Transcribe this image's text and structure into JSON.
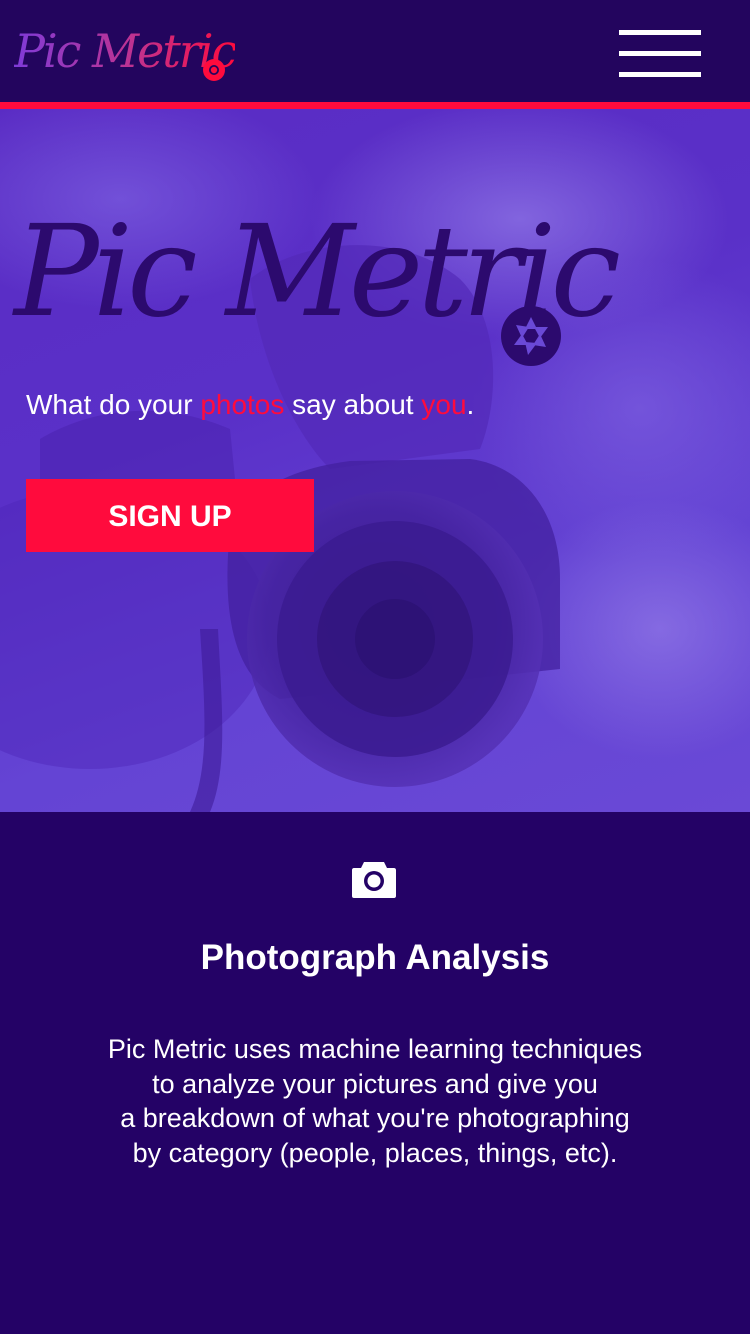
{
  "colors": {
    "header_bg": "#23055e",
    "accent": "#ff0b3d",
    "hero_bg": "#5a30c8",
    "section_bg": "#240266",
    "logo_text": "#2c0a6e",
    "text_light": "#ffffff"
  },
  "header": {
    "logo_text": "Pic Metric",
    "logo_icon": "aperture-icon",
    "menu_icon": "hamburger-menu-icon"
  },
  "hero": {
    "title": "Pic Metric",
    "title_icon": "aperture-icon",
    "tagline_parts": {
      "p1": "What do your ",
      "p2": "photos",
      "p3": " say about ",
      "p4": "you",
      "p5": "."
    },
    "signup_label": "SIGN UP",
    "background_image": "hand-holding-camera-photo"
  },
  "feature": {
    "icon": "camera-icon",
    "title": "Photograph Analysis",
    "text_lines": [
      "Pic Metric uses machine learning techniques",
      "to analyze your pictures and give you",
      "a breakdown of what you're photographing",
      "by category (people, places, things, etc)."
    ]
  }
}
